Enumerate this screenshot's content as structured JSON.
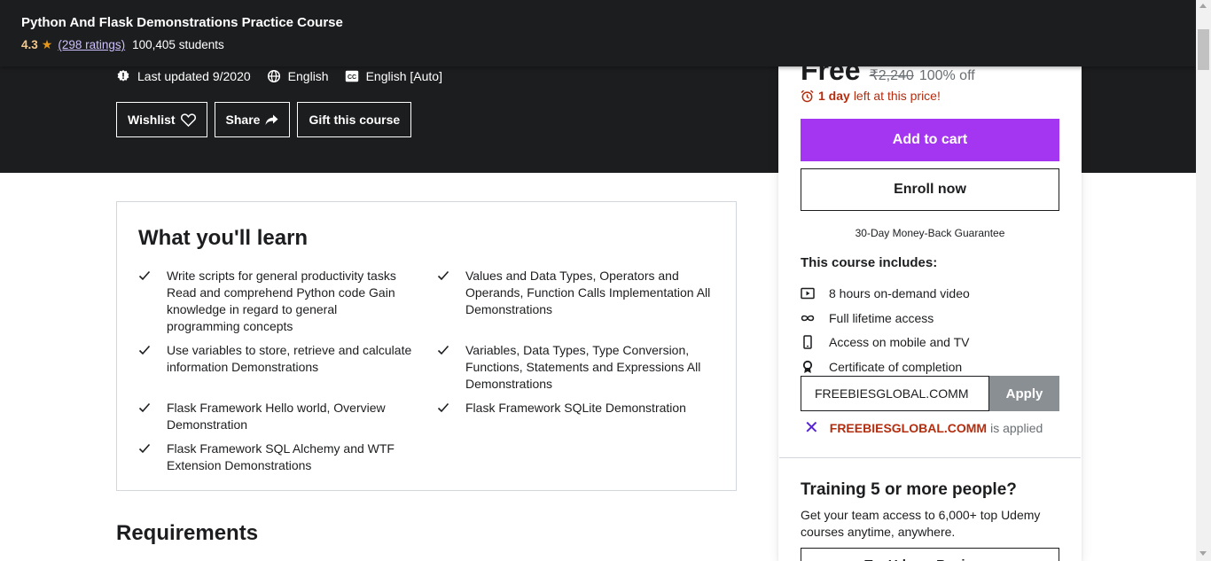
{
  "sticky_header": {
    "title": "Python And Flask Demonstrations Practice Course",
    "rating": "4.3",
    "ratings_link": "(298 ratings)",
    "students": "100,405 students"
  },
  "hero": {
    "last_updated": "Last updated 9/2020",
    "language": "English",
    "captions": "English [Auto]",
    "wishlist_label": "Wishlist",
    "share_label": "Share",
    "gift_label": "Gift this course"
  },
  "sidebar": {
    "price": "Free",
    "original_price": "₹2,240",
    "discount": "100% off",
    "timer_bold": "1 day",
    "timer_rest": "left at this price!",
    "add_to_cart": "Add to cart",
    "enroll_now": "Enroll now",
    "guarantee": "30-Day Money-Back Guarantee",
    "includes_title": "This course includes:",
    "includes": [
      {
        "icon": "video-icon",
        "label": "8 hours on-demand video"
      },
      {
        "icon": "infinity-icon",
        "label": "Full lifetime access"
      },
      {
        "icon": "mobile-icon",
        "label": "Access on mobile and TV"
      },
      {
        "icon": "certificate-icon",
        "label": "Certificate of completion"
      }
    ],
    "coupon_value": "FREEBIESGLOBAL.COMM",
    "apply_label": "Apply",
    "applied_code": "FREEBIESGLOBAL.COMM",
    "applied_text": "is applied",
    "training_title": "Training 5 or more people?",
    "training_desc": "Get your team access to 6,000+ top Udemy courses anytime, anywhere.",
    "training_button": "Try Udemy Business"
  },
  "learn": {
    "title": "What you'll learn",
    "items": [
      "Write scripts for general productivity tasks Read and comprehend Python code Gain knowledge in regard to general programming concepts",
      "Values and Data Types, Operators and Operands, Function Calls Implementation All Demonstrations",
      "Use variables to store, retrieve and calculate information Demonstrations",
      "Variables, Data Types, Type Conversion, Functions, Statements and Expressions All Demonstrations",
      "Flask Framework Hello world, Overview Demonstration",
      "Flask Framework SQLite Demonstration",
      "Flask Framework SQL Alchemy and WTF Extension Demonstrations"
    ]
  },
  "requirements": {
    "title": "Requirements"
  },
  "colors": {
    "dark": "#1c1d1f",
    "purple": "#a435f0",
    "price_red": "#b32d0f",
    "rating_gold": "#f3ca8c",
    "rating_link": "#cec0fc"
  }
}
